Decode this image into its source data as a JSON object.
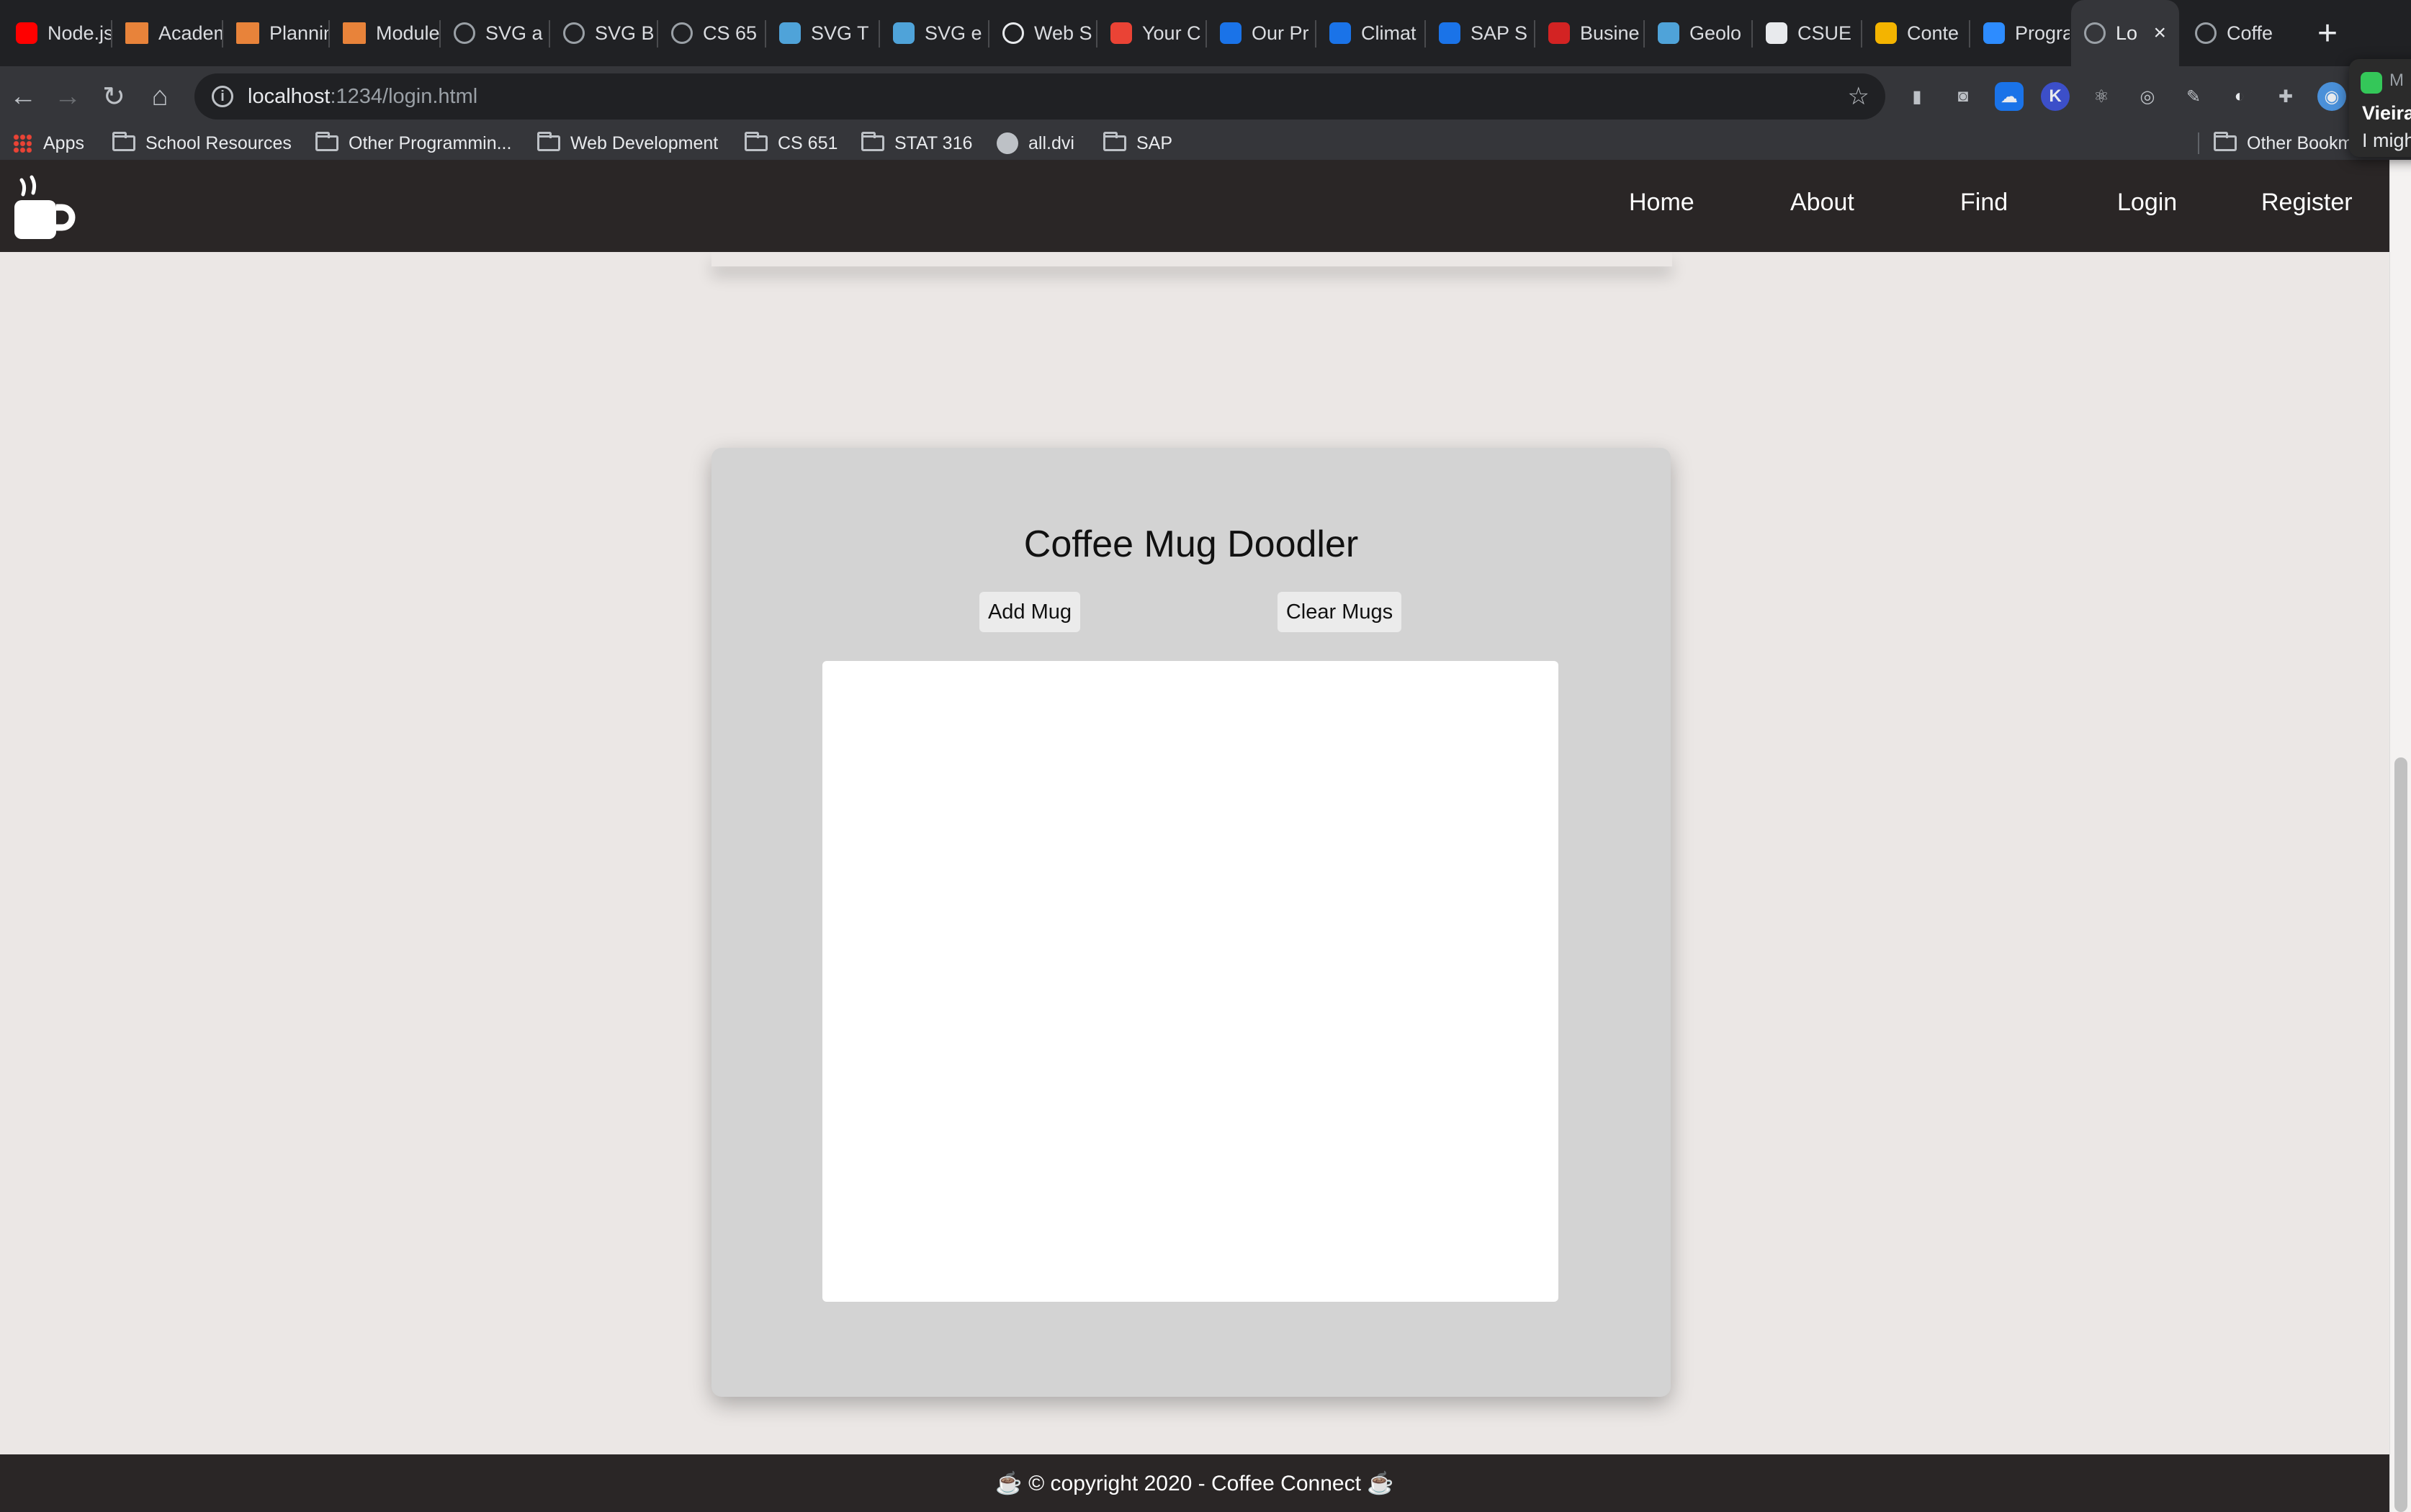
{
  "browser": {
    "tabs": [
      {
        "title": "Node.js",
        "favicon": "youtube-icon",
        "color": "#ff0000"
      },
      {
        "title": "Academic",
        "favicon": "bookmark-icon",
        "color": "#e8833a"
      },
      {
        "title": "Planning",
        "favicon": "bookmark-icon",
        "color": "#e8833a"
      },
      {
        "title": "Module",
        "favicon": "bookmark-icon",
        "color": "#e8833a"
      },
      {
        "title": "SVG a",
        "favicon": "globe-icon",
        "color": "#9aa0a6"
      },
      {
        "title": "SVG B",
        "favicon": "globe-icon",
        "color": "#9aa0a6"
      },
      {
        "title": "CS 65",
        "favicon": "globe-icon",
        "color": "#9aa0a6"
      },
      {
        "title": "SVG T",
        "favicon": "doc-icon",
        "color": "#4fa3d9"
      },
      {
        "title": "SVG e",
        "favicon": "doc-icon",
        "color": "#4fa3d9"
      },
      {
        "title": "Web S",
        "favicon": "globe-icon",
        "color": "#e8eaed"
      },
      {
        "title": "Your C",
        "favicon": "target-icon",
        "color": "#ea4335"
      },
      {
        "title": "Our Pr",
        "favicon": "sap-icon",
        "color": "#1a73e8"
      },
      {
        "title": "Climat",
        "favicon": "sap-icon",
        "color": "#1a73e8"
      },
      {
        "title": "SAP S",
        "favicon": "sap-icon",
        "color": "#1a73e8"
      },
      {
        "title": "Busine",
        "favicon": "yelp-icon",
        "color": "#d32323"
      },
      {
        "title": "Geolo",
        "favicon": "doc-icon",
        "color": "#4fa3d9"
      },
      {
        "title": "CSUE",
        "favicon": "github-icon",
        "color": "#e8eaed"
      },
      {
        "title": "Conte",
        "favicon": "pencil-icon",
        "color": "#f4b400"
      },
      {
        "title": "Progra",
        "favicon": "zoom-icon",
        "color": "#2d8cff"
      },
      {
        "title": "Lo",
        "favicon": "globe-icon",
        "color": "#9aa0a6",
        "active": true
      },
      {
        "title": "Coffe",
        "favicon": "globe-icon",
        "color": "#9aa0a6"
      }
    ],
    "url_host": "localhost",
    "url_path": ":1234/login.html",
    "bookmarks": [
      {
        "label": "Apps",
        "icon": "apps-icon"
      },
      {
        "label": "School Resources",
        "icon": "folder-icon"
      },
      {
        "label": "Other Programmin...",
        "icon": "folder-icon"
      },
      {
        "label": "Web Development",
        "icon": "folder-icon"
      },
      {
        "label": "CS 651",
        "icon": "folder-icon"
      },
      {
        "label": "STAT 316",
        "icon": "folder-icon"
      },
      {
        "label": "all.dvi",
        "icon": "globe-icon"
      },
      {
        "label": "SAP",
        "icon": "folder-icon"
      },
      {
        "label": "Other Bookm",
        "icon": "folder-icon"
      }
    ]
  },
  "notification": {
    "app": "M",
    "sender": "Vieira",
    "message": "I migh"
  },
  "site": {
    "nav": {
      "home": "Home",
      "about": "About",
      "find": "Find",
      "login": "Login",
      "register": "Register"
    },
    "doodler": {
      "title": "Coffee Mug Doodler",
      "add_button": "Add Mug",
      "clear_button": "Clear Mugs"
    },
    "footer": "☕ © copyright 2020 - Coffee Connect ☕"
  },
  "colors": {
    "nav_bg": "#2a2626",
    "page_bg": "#ebe7e5",
    "card_bg": "#d3d3d3",
    "canvas_bg": "#ffffff"
  }
}
